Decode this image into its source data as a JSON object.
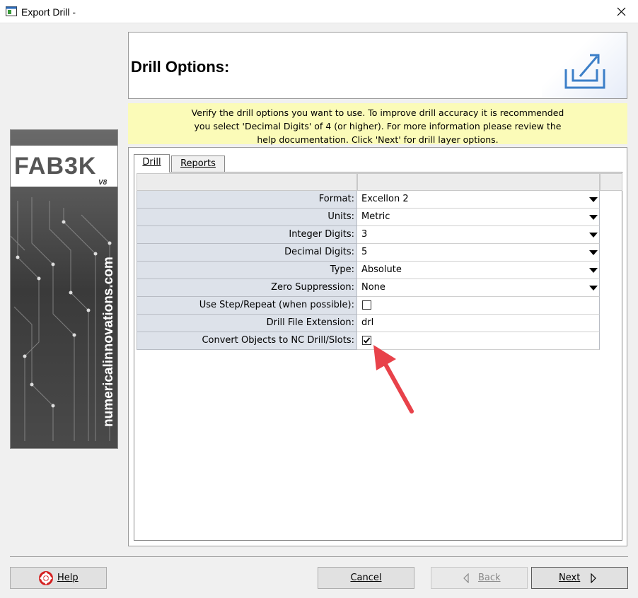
{
  "window": {
    "title": "Export Drill -",
    "close_symbol": "✕"
  },
  "logo": {
    "brand": "FAB3K",
    "version": "V8",
    "website": "numericalinnovations.com"
  },
  "header": {
    "title": "Drill Options:"
  },
  "info": {
    "text": "Verify the drill options you want to use. To improve drill accuracy it is recommended\nyou select 'Decimal Digits' of 4 (or higher). For more information please review the\nhelp documentation. Click 'Next' for drill layer options."
  },
  "tabs": [
    {
      "label": "Drill",
      "active": true
    },
    {
      "label": "Reports",
      "active": false
    }
  ],
  "options": [
    {
      "label": "Format:",
      "value": "Excellon 2",
      "kind": "dropdown"
    },
    {
      "label": "Units:",
      "value": "Metric",
      "kind": "dropdown"
    },
    {
      "label": "Integer Digits:",
      "value": "3",
      "kind": "dropdown"
    },
    {
      "label": "Decimal Digits:",
      "value": "5",
      "kind": "dropdown"
    },
    {
      "label": "Type:",
      "value": "Absolute",
      "kind": "dropdown"
    },
    {
      "label": "Zero Suppression:",
      "value": "None",
      "kind": "dropdown"
    },
    {
      "label": "Use Step/Repeat (when possible):",
      "checked": false,
      "kind": "checkbox"
    },
    {
      "label": "Drill File Extension:",
      "value": "drl",
      "kind": "text"
    },
    {
      "label": "Convert Objects to NC Drill/Slots:",
      "checked": true,
      "kind": "checkbox"
    }
  ],
  "buttons": {
    "help": "Help",
    "cancel": "Cancel",
    "back": "Back",
    "next": "Next"
  },
  "colors": {
    "banner": "#fbfbb8",
    "label_cell": "#dde2ea",
    "annotation_arrow": "#e8424a",
    "icon_blue": "#3c7fc8"
  }
}
